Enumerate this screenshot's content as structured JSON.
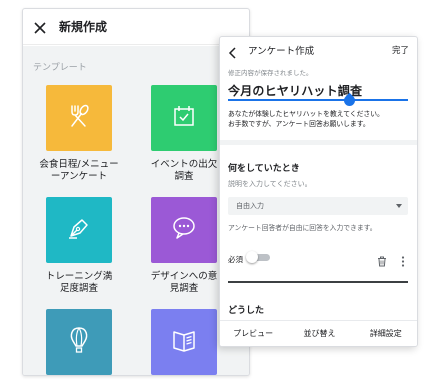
{
  "new_panel": {
    "title": "新規作成",
    "section_label": "テンプレート",
    "templates": [
      {
        "label": "会食日程/メニュー\nーアンケート",
        "color": "#f6b93b",
        "icon": "fork-spoon-icon"
      },
      {
        "label": "イベントの出欠\n調査",
        "color": "#2ecc71",
        "icon": "calendar-check-icon"
      },
      {
        "label": "トレーニング満\n足度調査",
        "color": "#1fb8c5",
        "icon": "pen-nib-icon"
      },
      {
        "label": "デザインへの意\n見調査",
        "color": "#9b59d6",
        "icon": "speech-bubble-icon"
      },
      {
        "label": "",
        "color": "#3e9bb8",
        "icon": "hot-air-balloon-icon"
      },
      {
        "label": "",
        "color": "#7b7ff0",
        "icon": "open-book-icon"
      }
    ]
  },
  "survey_panel": {
    "title": "アンケート作成",
    "done_label": "完了",
    "saved_note": "修正内容が保存されました。",
    "survey_title": "今月のヒヤリハット調査",
    "description_line1": "あなたが体験したヒヤリハットを教えてください。",
    "description_line2": "お手数ですが、アンケート回答お願いします。",
    "question1": {
      "title": "何をしていたとき",
      "description_placeholder": "説明を入力してください。",
      "answer_type": "自由入力",
      "answer_help": "アンケート回答者が自由に回答を入力できます。",
      "required_label": "必須",
      "required": false
    },
    "question2": {
      "title": "どうした"
    },
    "bottom_bar": {
      "preview": "プレビュー",
      "reorder": "並び替え",
      "settings": "詳細設定"
    },
    "accent_color": "#1a73e8"
  }
}
